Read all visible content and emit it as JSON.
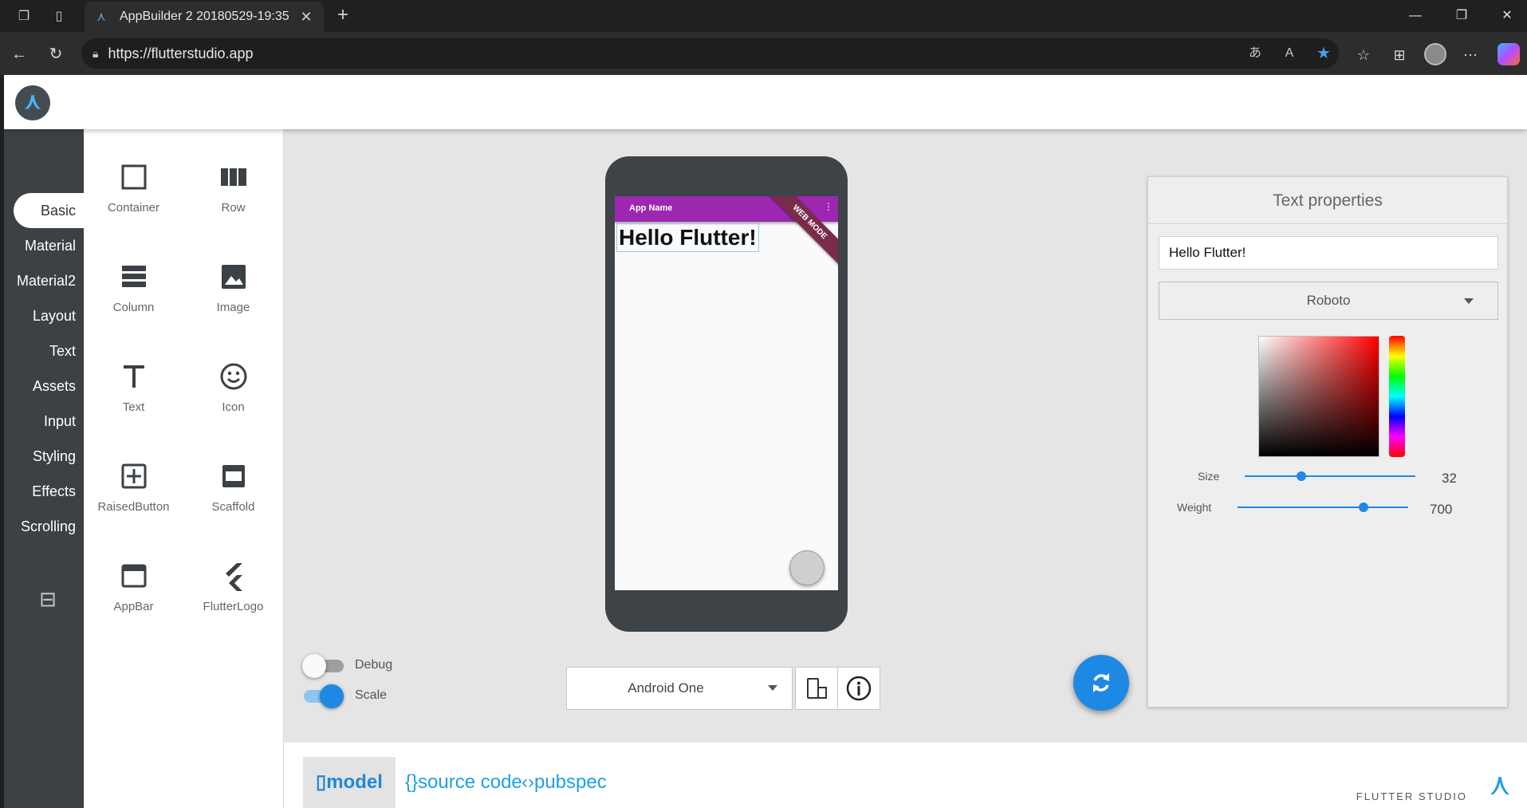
{
  "browser": {
    "tab_title": "AppBuilder 2 20180529-19:35",
    "url_host": "https://flutterstudio.app"
  },
  "sidebar": {
    "items": [
      {
        "label": "Basic"
      },
      {
        "label": "Material"
      },
      {
        "label": "Material2"
      },
      {
        "label": "Layout"
      },
      {
        "label": "Text"
      },
      {
        "label": "Assets"
      },
      {
        "label": "Input"
      },
      {
        "label": "Styling"
      },
      {
        "label": "Effects"
      },
      {
        "label": "Scrolling"
      }
    ],
    "active": "Basic"
  },
  "palette": {
    "widgets": [
      {
        "label": "Container",
        "icon": "container-icon"
      },
      {
        "label": "Row",
        "icon": "row-icon"
      },
      {
        "label": "Column",
        "icon": "column-icon"
      },
      {
        "label": "Image",
        "icon": "image-icon"
      },
      {
        "label": "Text",
        "icon": "text-icon"
      },
      {
        "label": "Icon",
        "icon": "smiley-icon"
      },
      {
        "label": "RaisedButton",
        "icon": "add-box-icon"
      },
      {
        "label": "Scaffold",
        "icon": "scaffold-icon"
      },
      {
        "label": "AppBar",
        "icon": "appbar-icon"
      },
      {
        "label": "FlutterLogo",
        "icon": "flutter-logo-icon"
      }
    ]
  },
  "preview": {
    "app_name": "App Name",
    "ribbon": "WEB MODE",
    "hello_text": "Hello Flutter!",
    "debug_label": "Debug",
    "debug_on": false,
    "scale_label": "Scale",
    "scale_on": true,
    "device": "Android One"
  },
  "properties": {
    "title": "Text properties",
    "text_value": "Hello Flutter!",
    "font": "Roboto",
    "color_hue": "#ff0000",
    "size_label": "Size",
    "size_value": "32",
    "size_fraction": 0.33,
    "weight_label": "Weight",
    "weight_value": "700",
    "weight_fraction": 0.74
  },
  "bottom_tabs": [
    {
      "label": "model",
      "active": true
    },
    {
      "label": "source code",
      "active": false
    },
    {
      "label": "pubspec",
      "active": false
    }
  ],
  "brand": "FLUTTER STUDIO"
}
